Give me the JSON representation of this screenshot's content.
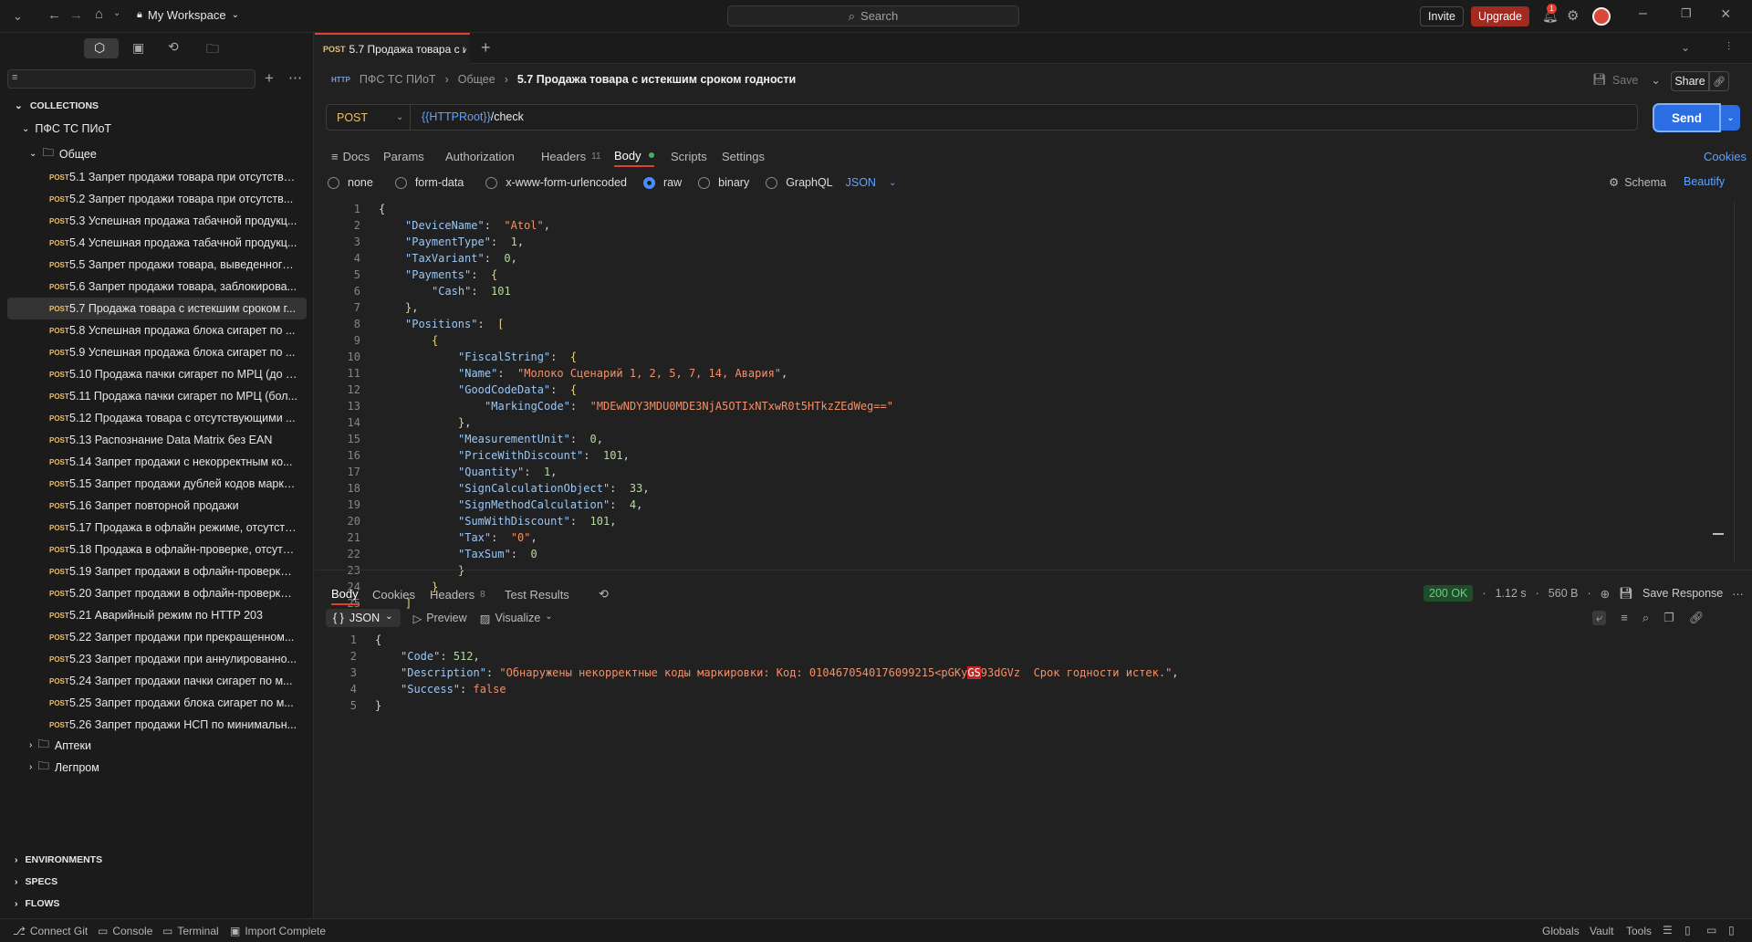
{
  "topbar": {
    "workspace": "My Workspace",
    "search": "Search",
    "invite": "Invite",
    "upgrade": "Upgrade",
    "notif_count": "1"
  },
  "sidebar": {
    "section_collections": "COLLECTIONS",
    "collection": "ПФС ТС ПИоТ",
    "folder_general": "Общее",
    "method": "POST",
    "requests": [
      "5.1 Запрет продажи товара при отсутстви...",
      "5.2 Запрет продажи товара при отсутств...",
      "5.3 Успешная продажа табачной продукц...",
      "5.4 Успешная продажа табачной продукц...",
      "5.5 Запрет продажи товара, выведенного...",
      "5.6 Запрет продажи товара, заблокирова...",
      "5.7 Продажа товара с истекшим сроком г...",
      "5.8 Успешная продажа блока сигарет по ...",
      "5.9 Успешная продажа блока сигарет по ...",
      "5.10 Продажа пачки сигарет по МРЦ (до 1...",
      "5.11 Продажа пачки сигарет по МРЦ (бол...",
      "5.12 Продажа товара с отсутствующими ...",
      "5.13 Распознание Data Matrix без EAN",
      "5.14 Запрет продажи с некорректным ко...",
      "5.15 Запрет продажи дублей кодов марки...",
      "5.16 Запрет повторной продажи",
      "5.17 Продажа в офлайн режиме, отсутств...",
      "5.18 Продажа в офлайн-проверке, отсутс...",
      "5.19 Запрет продажи в офлайн-проверке,...",
      "5.20 Запрет продажи в офлайн-проверке ...",
      "5.21 Аварийный режим по HTTP 203",
      "5.22 Запрет продажи при прекращенном...",
      "5.23 Запрет продажи при аннулированно...",
      "5.24 Запрет продажи пачки сигарет по м...",
      "5.25 Запрет продажи блока сигарет по м...",
      "5.26 Запрет продажи НСП по минимальн..."
    ],
    "folder_pharma": "Аптеки",
    "folder_light": "Легпром",
    "environments": "ENVIRONMENTS",
    "specs": "SPECS",
    "flows": "FLOWS"
  },
  "tab": {
    "method": "POST",
    "title": "5.7 Продажа товара с и"
  },
  "breadcrumb": {
    "collection": "ПФС ТС ПИоТ",
    "folder": "Общее",
    "current": "5.7 Продажа товара с истекшим сроком годности",
    "save": "Save",
    "share": "Share"
  },
  "request": {
    "method": "POST",
    "url_var": "{{HTTPRoot}}",
    "url_path": " /check",
    "send": "Send"
  },
  "req_tabs": {
    "docs": "Docs",
    "params": "Params",
    "auth": "Authorization",
    "headers": "Headers",
    "headers_count": "11",
    "body": "Body",
    "scripts": "Scripts",
    "settings": "Settings",
    "cookies": "Cookies"
  },
  "body_types": {
    "none": "none",
    "form_data": "form-data",
    "urlencoded": "x-www-form-urlencoded",
    "raw": "raw",
    "binary": "binary",
    "graphql": "GraphQL",
    "format": "JSON",
    "schema": "Schema",
    "beautify": "Beautify"
  },
  "resp_tabs": {
    "body": "Body",
    "cookies": "Cookies",
    "headers": "Headers",
    "headers_count": "8",
    "tests": "Test Results",
    "status": "200 OK",
    "time": "1.12 s",
    "size": "560 B",
    "save_response": "Save Response"
  },
  "resp_view": {
    "format": "JSON",
    "preview": "Preview",
    "visualize": "Visualize"
  },
  "statusbar": {
    "connect": "Connect Git",
    "console": "Console",
    "terminal": "Terminal",
    "import": "Import Complete",
    "globals": "Globals",
    "vault": "Vault",
    "tools": "Tools"
  }
}
